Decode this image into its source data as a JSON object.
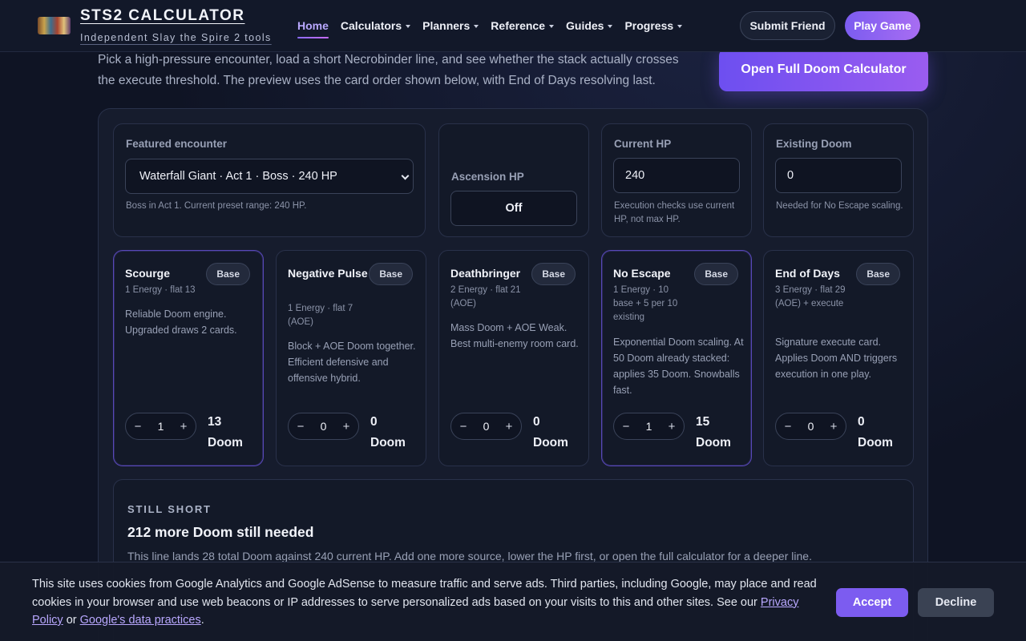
{
  "header": {
    "brand_title": "STS2 CALCULATOR",
    "brand_subtitle": "Independent Slay the Spire 2 tools",
    "nav": [
      {
        "label": "Home",
        "active": true,
        "dropdown": false
      },
      {
        "label": "Calculators",
        "dropdown": true
      },
      {
        "label": "Planners",
        "dropdown": true
      },
      {
        "label": "Reference",
        "dropdown": true
      },
      {
        "label": "Guides",
        "dropdown": true
      },
      {
        "label": "Progress",
        "dropdown": true
      }
    ],
    "submit_label": "Submit Friend",
    "play_label": "Play Game"
  },
  "intro": {
    "text": "Pick a high-pressure encounter, load a short Necrobinder line, and see whether the stack actually crosses the execute threshold. The preview uses the card order shown below, with End of Days resolving last.",
    "full_button": "Open Full Doom Calculator"
  },
  "controls": {
    "encounter_label": "Featured encounter",
    "encounter_value": "Waterfall Giant · Act 1 · Boss · 240 HP",
    "encounter_help": "Boss in Act 1. Current preset range: 240 HP.",
    "ascension_label": "Ascension HP",
    "ascension_value": "Off",
    "hp_label": "Current HP",
    "hp_value": "240",
    "hp_help": "Execution checks use current HP, not max HP.",
    "doom_label": "Existing Doom",
    "doom_value": "0",
    "doom_help": "Needed for No Escape scaling."
  },
  "cards": [
    {
      "name": "Scourge",
      "badge": "Base",
      "meta": "1 Energy · flat 13",
      "desc": "Reliable Doom engine. Upgraded draws 2 cards.",
      "count": "1",
      "doom_num": "13",
      "doom_unit": "Doom",
      "selected": true
    },
    {
      "name": "Negative Pulse",
      "badge": "Base",
      "meta": "1 Energy · flat 7 (AOE)",
      "desc": "Block + AOE Doom together. Efficient defensive and offensive hybrid.",
      "count": "0",
      "doom_num": "0",
      "doom_unit": "Doom",
      "selected": false
    },
    {
      "name": "Deathbringer",
      "badge": "Base",
      "meta": "2 Energy · flat 21 (AOE)",
      "desc": "Mass Doom + AOE Weak. Best multi-enemy room card.",
      "count": "0",
      "doom_num": "0",
      "doom_unit": "Doom",
      "selected": false
    },
    {
      "name": "No Escape",
      "badge": "Base",
      "meta": "1 Energy · 10 base + 5 per 10 existing",
      "desc": "Exponential Doom scaling. At 50 Doom already stacked: applies 35 Doom. Snowballs fast.",
      "count": "1",
      "doom_num": "15",
      "doom_unit": "Doom",
      "selected": true
    },
    {
      "name": "End of Days",
      "badge": "Base",
      "meta": "3 Energy · flat 29 (AOE) + execute",
      "desc": "Signature execute card. Applies Doom AND triggers execution in one play.",
      "count": "0",
      "doom_num": "0",
      "doom_unit": "Doom",
      "selected": false
    }
  ],
  "stepper": {
    "minus": "−",
    "plus": "+"
  },
  "result": {
    "kicker": "STILL SHORT",
    "title": "212 more Doom still needed",
    "detail": "This line lands 28 total Doom against 240 current HP. Add one more source, lower the HP first, or open the full calculator for a deeper line."
  },
  "cookie": {
    "text_before": "This site uses cookies from Google Analytics and Google AdSense to measure traffic and serve ads. Third parties, including Google, may place and read cookies in your browser and use web beacons or IP addresses to serve personalized ads based on your visits to this and other sites. See our ",
    "privacy_link": "Privacy Policy",
    "text_middle": " or ",
    "google_link": "Google's data practices",
    "text_after": ".",
    "accept": "Accept",
    "decline": "Decline"
  },
  "colors": {
    "accent": "#7c5cf0",
    "accent_light": "#b9a8ff",
    "bg": "#0f1424",
    "panel": "#161c2d"
  }
}
